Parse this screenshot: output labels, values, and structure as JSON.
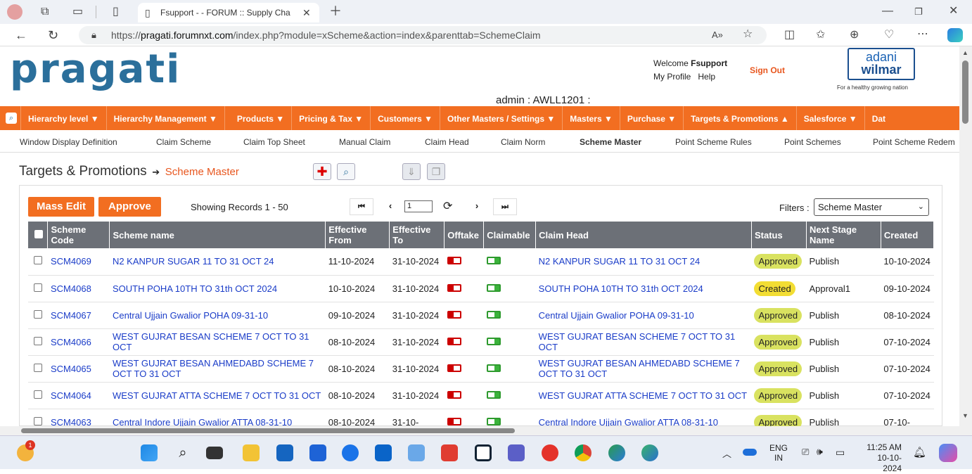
{
  "browser": {
    "tab_title": "Fsupport - - FORUM :: Supply Cha",
    "url_prefix": "https://",
    "url_domain": "pragati.forumnxt.com",
    "url_path": "/index.php?module=xScheme&action=index&parenttab=SchemeClaim"
  },
  "header": {
    "logo": "pragati",
    "welcome": "Welcome",
    "user": "Fsupport",
    "my_profile": "My Profile",
    "help": "Help",
    "sign_out": "Sign Out",
    "admin_label": "admin : AWLL1201 :",
    "brand_top": "adani",
    "brand_bottom": "wilmar",
    "tagline": "For a healthy growing nation"
  },
  "menu": [
    "Hierarchy level ▼",
    "Hierarchy Management ▼",
    "Products ▼",
    "Pricing & Tax ▼",
    "Customers ▼",
    "Other Masters / Settings ▼",
    "Masters ▼",
    "Purchase ▼",
    "Targets & Promotions ▲",
    "Salesforce ▼",
    "Dat"
  ],
  "submenu": [
    "Window Display Definition",
    "Claim Scheme",
    "Claim Top Sheet",
    "Manual Claim",
    "Claim Head",
    "Claim Norm",
    "Scheme Master",
    "Point Scheme Rules",
    "Point Schemes",
    "Point Scheme Redem"
  ],
  "breadcrumb": {
    "section": "Targets & Promotions",
    "arrow": "➔",
    "current": "Scheme Master"
  },
  "toolbar": {
    "mass_edit": "Mass Edit",
    "approve": "Approve",
    "records": "Showing Records 1 - 50",
    "page_value": "1",
    "filters_label": "Filters :",
    "filter_selected": "Scheme Master"
  },
  "table": {
    "headers": [
      "Scheme Code",
      "Scheme name",
      "Effective From",
      "Effective To",
      "Offtake",
      "Claimable",
      "Claim Head",
      "Status",
      "Next Stage Name",
      "Created"
    ],
    "rows": [
      {
        "code": "SCM4069",
        "name": "N2 KANPUR SUGAR 11 TO 31 OCT 24",
        "from": "11-10-2024",
        "to": "31-10-2024",
        "claim_head": "N2 KANPUR SUGAR 11 TO 31 OCT 24",
        "status": "Approved",
        "next": "Publish",
        "created": "10-10-2024"
      },
      {
        "code": "SCM4068",
        "name": "SOUTH POHA 10TH TO 31th OCT 2024",
        "from": "10-10-2024",
        "to": "31-10-2024",
        "claim_head": "SOUTH POHA 10TH TO 31th OCT 2024",
        "status": "Created",
        "next": "Approval1",
        "created": "09-10-2024"
      },
      {
        "code": "SCM4067",
        "name": "Central Ujjain Gwalior POHA 09-31-10",
        "from": "09-10-2024",
        "to": "31-10-2024",
        "claim_head": "Central Ujjain Gwalior POHA 09-31-10",
        "status": "Approved",
        "next": "Publish",
        "created": "08-10-2024"
      },
      {
        "code": "SCM4066",
        "name": "WEST GUJRAT BESAN SCHEME 7 OCT TO 31 OCT",
        "from": "08-10-2024",
        "to": "31-10-2024",
        "claim_head": "WEST GUJRAT BESAN SCHEME 7 OCT TO 31 OCT",
        "status": "Approved",
        "next": "Publish",
        "created": "07-10-2024"
      },
      {
        "code": "SCM4065",
        "name": "WEST GUJRAT BESAN AHMEDABD SCHEME 7 OCT TO 31 OCT",
        "from": "08-10-2024",
        "to": "31-10-2024",
        "claim_head": "WEST GUJRAT BESAN AHMEDABD SCHEME 7 OCT TO 31 OCT",
        "status": "Approved",
        "next": "Publish",
        "created": "07-10-2024"
      },
      {
        "code": "SCM4064",
        "name": "WEST GUJRAT ATTA SCHEME 7 OCT TO 31 OCT",
        "from": "08-10-2024",
        "to": "31-10-2024",
        "claim_head": "WEST GUJRAT ATTA SCHEME 7 OCT TO 31 OCT",
        "status": "Approved",
        "next": "Publish",
        "created": "07-10-2024"
      },
      {
        "code": "SCM4063",
        "name": "Central Indore Ujjain Gwalior ATTA 08-31-10",
        "from": "08-10-2024",
        "to": "31-10-",
        "claim_head": "Central Indore Ujjain Gwalior ATTA 08-31-10",
        "status": "Approved",
        "next": "Publish",
        "created": "07-10-"
      }
    ]
  },
  "taskbar": {
    "lang_top": "ENG",
    "lang_bottom": "IN",
    "time": "11:25 AM",
    "date": "10-10-2024",
    "weather_badge": "1"
  }
}
